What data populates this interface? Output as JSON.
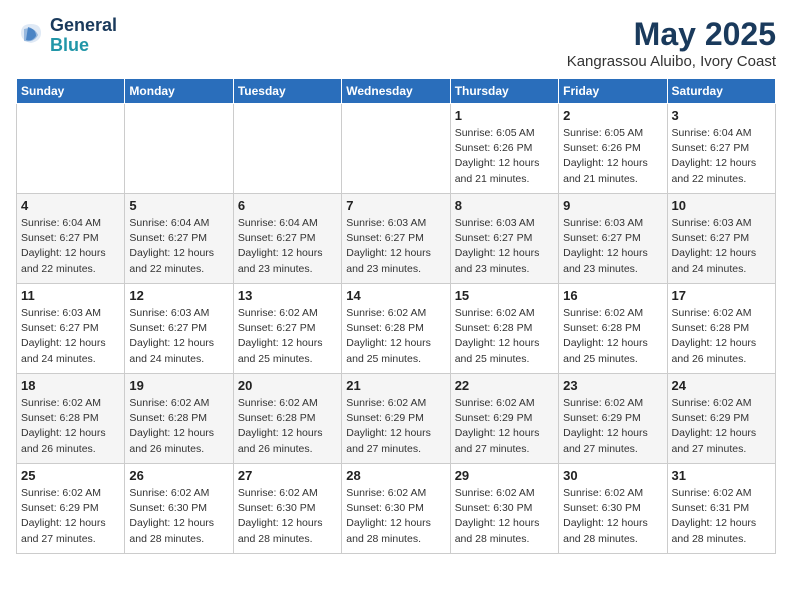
{
  "header": {
    "logo_line1": "General",
    "logo_line2": "Blue",
    "month_title": "May 2025",
    "subtitle": "Kangrassou Aluibo, Ivory Coast"
  },
  "weekdays": [
    "Sunday",
    "Monday",
    "Tuesday",
    "Wednesday",
    "Thursday",
    "Friday",
    "Saturday"
  ],
  "weeks": [
    [
      {
        "day": "",
        "info": ""
      },
      {
        "day": "",
        "info": ""
      },
      {
        "day": "",
        "info": ""
      },
      {
        "day": "",
        "info": ""
      },
      {
        "day": "1",
        "info": "Sunrise: 6:05 AM\nSunset: 6:26 PM\nDaylight: 12 hours\nand 21 minutes."
      },
      {
        "day": "2",
        "info": "Sunrise: 6:05 AM\nSunset: 6:26 PM\nDaylight: 12 hours\nand 21 minutes."
      },
      {
        "day": "3",
        "info": "Sunrise: 6:04 AM\nSunset: 6:27 PM\nDaylight: 12 hours\nand 22 minutes."
      }
    ],
    [
      {
        "day": "4",
        "info": "Sunrise: 6:04 AM\nSunset: 6:27 PM\nDaylight: 12 hours\nand 22 minutes."
      },
      {
        "day": "5",
        "info": "Sunrise: 6:04 AM\nSunset: 6:27 PM\nDaylight: 12 hours\nand 22 minutes."
      },
      {
        "day": "6",
        "info": "Sunrise: 6:04 AM\nSunset: 6:27 PM\nDaylight: 12 hours\nand 23 minutes."
      },
      {
        "day": "7",
        "info": "Sunrise: 6:03 AM\nSunset: 6:27 PM\nDaylight: 12 hours\nand 23 minutes."
      },
      {
        "day": "8",
        "info": "Sunrise: 6:03 AM\nSunset: 6:27 PM\nDaylight: 12 hours\nand 23 minutes."
      },
      {
        "day": "9",
        "info": "Sunrise: 6:03 AM\nSunset: 6:27 PM\nDaylight: 12 hours\nand 23 minutes."
      },
      {
        "day": "10",
        "info": "Sunrise: 6:03 AM\nSunset: 6:27 PM\nDaylight: 12 hours\nand 24 minutes."
      }
    ],
    [
      {
        "day": "11",
        "info": "Sunrise: 6:03 AM\nSunset: 6:27 PM\nDaylight: 12 hours\nand 24 minutes."
      },
      {
        "day": "12",
        "info": "Sunrise: 6:03 AM\nSunset: 6:27 PM\nDaylight: 12 hours\nand 24 minutes."
      },
      {
        "day": "13",
        "info": "Sunrise: 6:02 AM\nSunset: 6:27 PM\nDaylight: 12 hours\nand 25 minutes."
      },
      {
        "day": "14",
        "info": "Sunrise: 6:02 AM\nSunset: 6:28 PM\nDaylight: 12 hours\nand 25 minutes."
      },
      {
        "day": "15",
        "info": "Sunrise: 6:02 AM\nSunset: 6:28 PM\nDaylight: 12 hours\nand 25 minutes."
      },
      {
        "day": "16",
        "info": "Sunrise: 6:02 AM\nSunset: 6:28 PM\nDaylight: 12 hours\nand 25 minutes."
      },
      {
        "day": "17",
        "info": "Sunrise: 6:02 AM\nSunset: 6:28 PM\nDaylight: 12 hours\nand 26 minutes."
      }
    ],
    [
      {
        "day": "18",
        "info": "Sunrise: 6:02 AM\nSunset: 6:28 PM\nDaylight: 12 hours\nand 26 minutes."
      },
      {
        "day": "19",
        "info": "Sunrise: 6:02 AM\nSunset: 6:28 PM\nDaylight: 12 hours\nand 26 minutes."
      },
      {
        "day": "20",
        "info": "Sunrise: 6:02 AM\nSunset: 6:28 PM\nDaylight: 12 hours\nand 26 minutes."
      },
      {
        "day": "21",
        "info": "Sunrise: 6:02 AM\nSunset: 6:29 PM\nDaylight: 12 hours\nand 27 minutes."
      },
      {
        "day": "22",
        "info": "Sunrise: 6:02 AM\nSunset: 6:29 PM\nDaylight: 12 hours\nand 27 minutes."
      },
      {
        "day": "23",
        "info": "Sunrise: 6:02 AM\nSunset: 6:29 PM\nDaylight: 12 hours\nand 27 minutes."
      },
      {
        "day": "24",
        "info": "Sunrise: 6:02 AM\nSunset: 6:29 PM\nDaylight: 12 hours\nand 27 minutes."
      }
    ],
    [
      {
        "day": "25",
        "info": "Sunrise: 6:02 AM\nSunset: 6:29 PM\nDaylight: 12 hours\nand 27 minutes."
      },
      {
        "day": "26",
        "info": "Sunrise: 6:02 AM\nSunset: 6:30 PM\nDaylight: 12 hours\nand 28 minutes."
      },
      {
        "day": "27",
        "info": "Sunrise: 6:02 AM\nSunset: 6:30 PM\nDaylight: 12 hours\nand 28 minutes."
      },
      {
        "day": "28",
        "info": "Sunrise: 6:02 AM\nSunset: 6:30 PM\nDaylight: 12 hours\nand 28 minutes."
      },
      {
        "day": "29",
        "info": "Sunrise: 6:02 AM\nSunset: 6:30 PM\nDaylight: 12 hours\nand 28 minutes."
      },
      {
        "day": "30",
        "info": "Sunrise: 6:02 AM\nSunset: 6:30 PM\nDaylight: 12 hours\nand 28 minutes."
      },
      {
        "day": "31",
        "info": "Sunrise: 6:02 AM\nSunset: 6:31 PM\nDaylight: 12 hours\nand 28 minutes."
      }
    ]
  ]
}
